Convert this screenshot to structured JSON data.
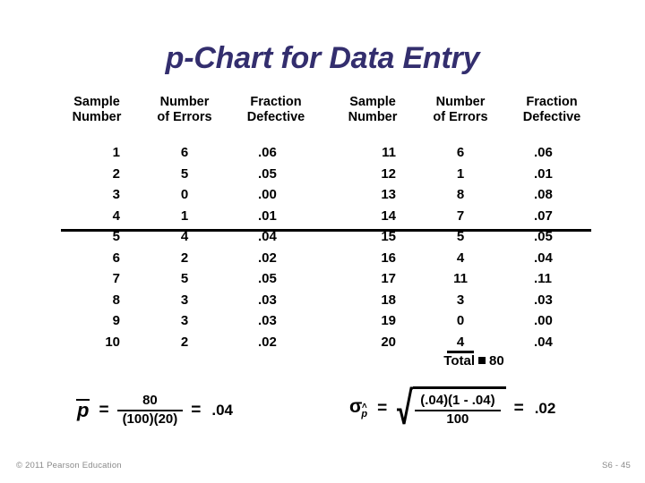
{
  "slide": {
    "title": "p-Chart for Data Entry",
    "title_color": "#332e6e"
  },
  "tables": {
    "headers": {
      "sample_l1": "Sample",
      "sample_l2": "Number",
      "errors_l1": "Number",
      "errors_l2": "of Errors",
      "fraction_l1": "Fraction",
      "fraction_l2": "Defective"
    },
    "left_rows": [
      {
        "sample": "1",
        "errors": "6",
        "fraction": ".06"
      },
      {
        "sample": "2",
        "errors": "5",
        "fraction": ".05"
      },
      {
        "sample": "3",
        "errors": "0",
        "fraction": ".00"
      },
      {
        "sample": "4",
        "errors": "1",
        "fraction": ".01"
      },
      {
        "sample": "5",
        "errors": "4",
        "fraction": ".04"
      },
      {
        "sample": "6",
        "errors": "2",
        "fraction": ".02"
      },
      {
        "sample": "7",
        "errors": "5",
        "fraction": ".05"
      },
      {
        "sample": "8",
        "errors": "3",
        "fraction": ".03"
      },
      {
        "sample": "9",
        "errors": "3",
        "fraction": ".03"
      },
      {
        "sample": "10",
        "errors": "2",
        "fraction": ".02"
      }
    ],
    "right_rows": [
      {
        "sample": "11",
        "errors": "6",
        "fraction": ".06"
      },
      {
        "sample": "12",
        "errors": "1",
        "fraction": ".01"
      },
      {
        "sample": "13",
        "errors": "8",
        "fraction": ".08"
      },
      {
        "sample": "14",
        "errors": "7",
        "fraction": ".07"
      },
      {
        "sample": "15",
        "errors": "5",
        "fraction": ".05"
      },
      {
        "sample": "16",
        "errors": "4",
        "fraction": ".04"
      },
      {
        "sample": "17",
        "errors": "11",
        "fraction": ".11"
      },
      {
        "sample": "18",
        "errors": "3",
        "fraction": ".03"
      },
      {
        "sample": "19",
        "errors": "0",
        "fraction": ".00"
      },
      {
        "sample": "20",
        "errors": "4",
        "fraction": ".04"
      }
    ],
    "total_label": "Total",
    "total_value": "80"
  },
  "formulas": {
    "pbar": {
      "symbol": "p",
      "equals": "=",
      "numerator": "80",
      "denominator": "(100)(20)",
      "equals2": "=",
      "result": ".04"
    },
    "sigma": {
      "symbol": "σ",
      "subscript": "p",
      "hat": "˄",
      "equals": "=",
      "numerator": "(.04)(1 - .04)",
      "denominator": "100",
      "equals2": "=",
      "result": ".02"
    }
  },
  "footer": {
    "copyright": "© 2011 Pearson Education",
    "page": "S6 - 45"
  },
  "chart_data": {
    "type": "table",
    "title": "p-Chart for Data Entry",
    "columns": [
      "Sample Number",
      "Number of Errors",
      "Fraction Defective"
    ],
    "sample_numbers": [
      1,
      2,
      3,
      4,
      5,
      6,
      7,
      8,
      9,
      10,
      11,
      12,
      13,
      14,
      15,
      16,
      17,
      18,
      19,
      20
    ],
    "number_of_errors": [
      6,
      5,
      0,
      1,
      4,
      2,
      5,
      3,
      3,
      2,
      6,
      1,
      8,
      7,
      5,
      4,
      11,
      3,
      0,
      4
    ],
    "fraction_defective": [
      0.06,
      0.05,
      0.0,
      0.01,
      0.04,
      0.02,
      0.05,
      0.03,
      0.03,
      0.02,
      0.06,
      0.01,
      0.08,
      0.07,
      0.05,
      0.04,
      0.11,
      0.03,
      0.0,
      0.04
    ],
    "total_errors": 80,
    "sample_size": 100,
    "number_of_samples": 20,
    "p_bar": 0.04,
    "sigma_p_hat": 0.02
  }
}
